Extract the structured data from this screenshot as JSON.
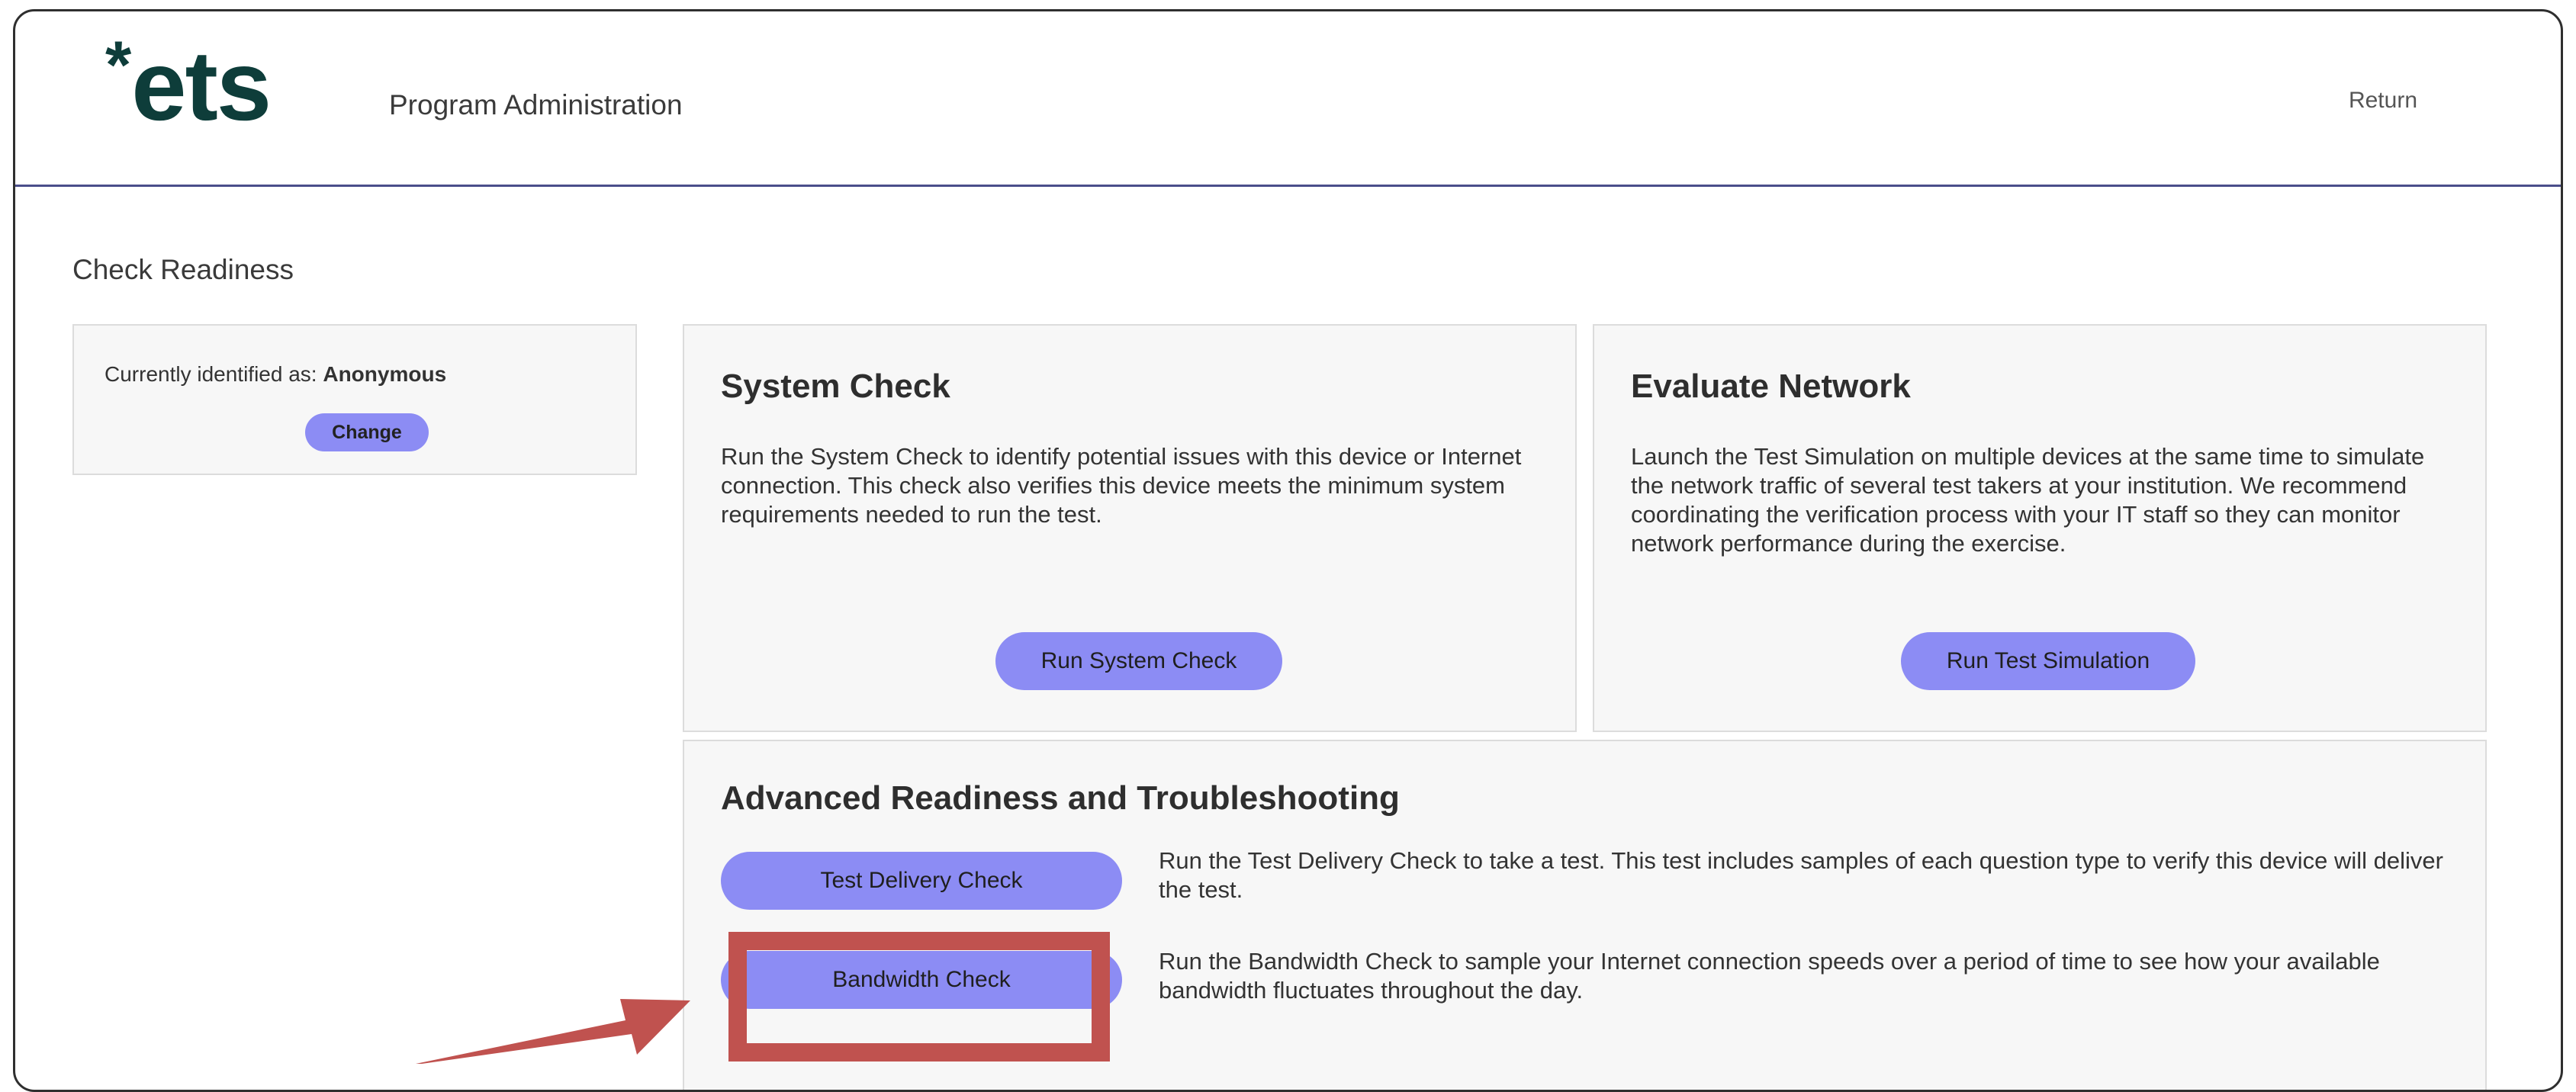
{
  "header": {
    "logo_star": "*",
    "logo_text": "ets",
    "program_name": "Program Administration",
    "return_label": "Return"
  },
  "page": {
    "title": "Check Readiness"
  },
  "identity": {
    "prefix": "Currently identified as:",
    "name": "Anonymous",
    "change_label": "Change"
  },
  "system_check": {
    "title": "System Check",
    "description": "Run the System Check to identify potential issues with this device or Internet connection. This check also verifies this device meets the minimum system requirements needed to run the test.",
    "button_label": "Run System Check"
  },
  "evaluate_network": {
    "title": "Evaluate Network",
    "description": "Launch the Test Simulation on multiple devices at the same time to simulate the network traffic of several test takers at your institution. We recommend coordinating the verification process with your IT staff so they can monitor network performance during the exercise.",
    "button_label": "Run Test Simulation"
  },
  "advanced": {
    "title": "Advanced Readiness and Troubleshooting",
    "items": [
      {
        "button_label": "Test Delivery Check",
        "description": "Run the Test Delivery Check to take a test. This test includes samples of each question type to verify this device will deliver the test."
      },
      {
        "button_label": "Bandwidth Check",
        "description": "Run the Bandwidth Check to sample your Internet connection speeds over a period of time to see how your available bandwidth fluctuates throughout the day."
      }
    ]
  },
  "colors": {
    "button": "#8c8cf4",
    "brand": "#0e3d3a",
    "header_rule": "#4a4e8a",
    "annotation": "#c0524f"
  },
  "icons": {
    "annotation_arrow": "arrow-icon"
  }
}
